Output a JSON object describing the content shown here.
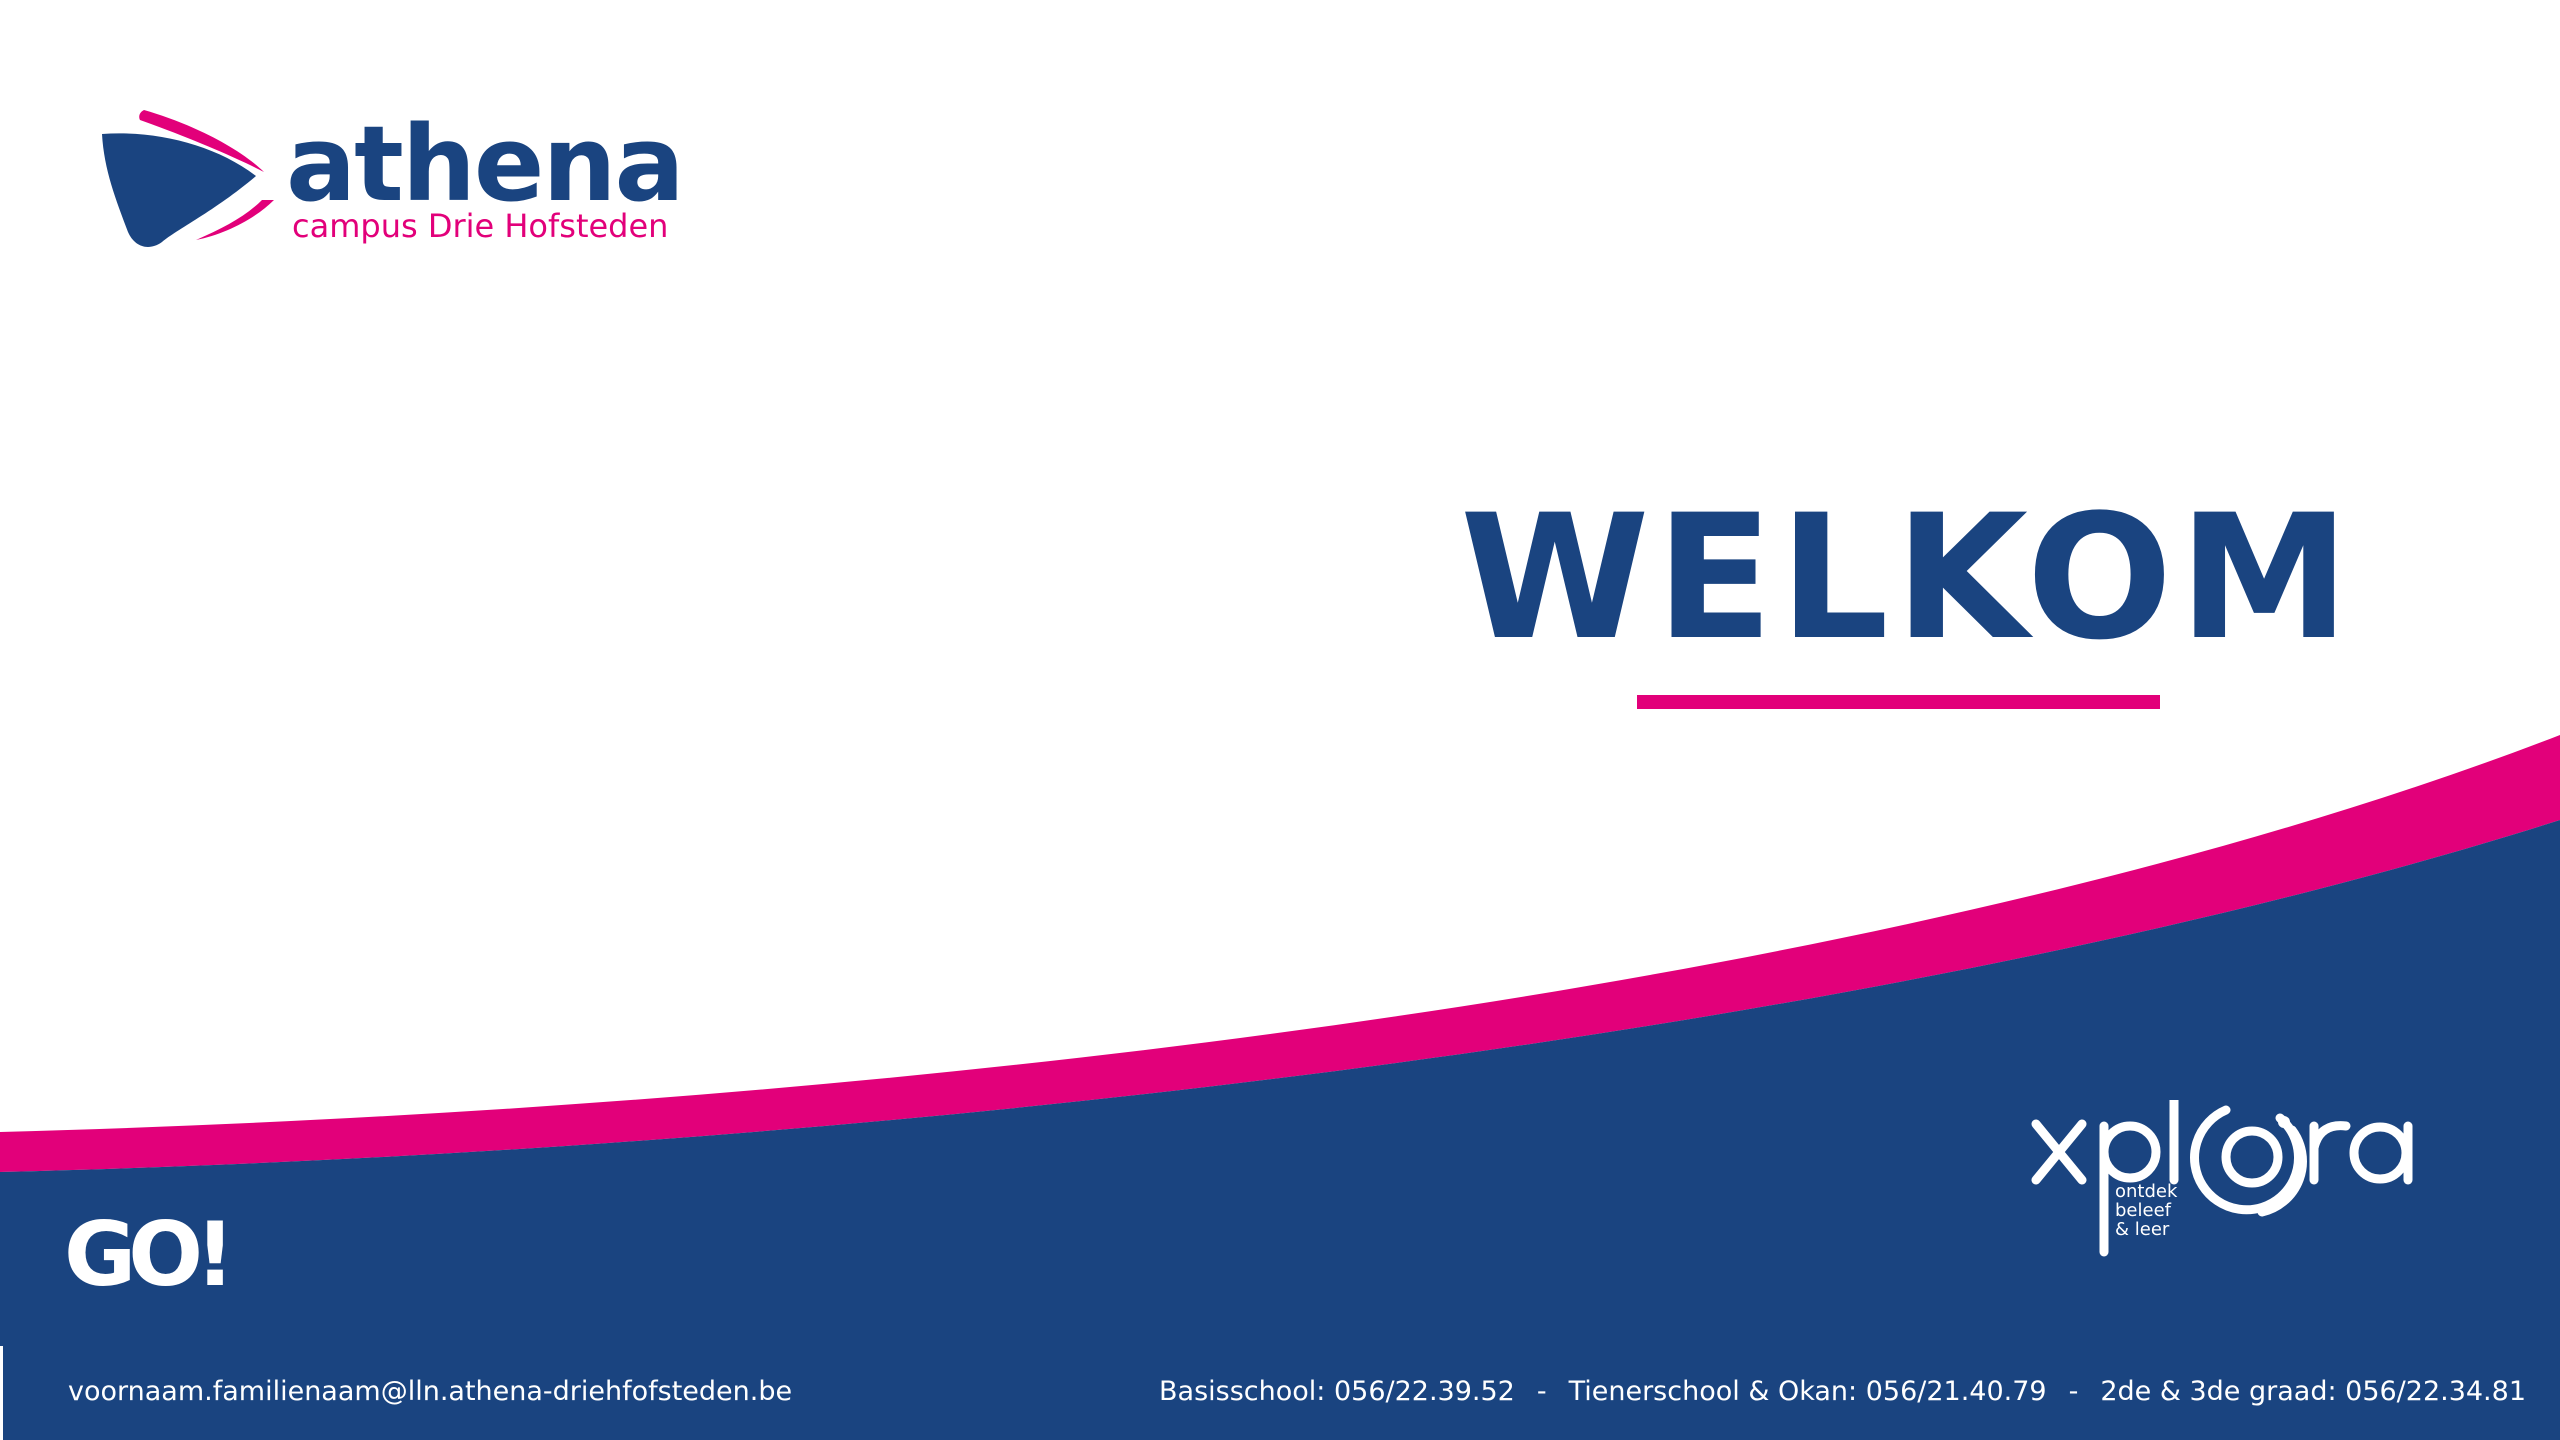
{
  "colors": {
    "brand_blue": "#1a4480",
    "brand_pink": "#e2007a",
    "background": "#ffffff",
    "footer_text": "#ffffff"
  },
  "header": {
    "logo_word": "athena",
    "logo_subtitle": "campus Drie Hofsteden"
  },
  "main": {
    "heading": "WELKOM"
  },
  "bottom": {
    "go_logo_text": "GO!",
    "xplora": {
      "word": "xplora",
      "tagline": [
        "ontdek",
        "beleef",
        "& leer"
      ]
    }
  },
  "footer": {
    "email": "voornaam.familienaam@lln.athena-driehfofsteden.be",
    "phones": [
      "Basisschool: 056/22.39.52",
      "Tienerschool & Okan: 056/21.40.79",
      "2de & 3de graad: 056/22.34.81"
    ],
    "separator": "-"
  },
  "icons": [
    "athena-logo-mark-icon",
    "go-logo-icon",
    "xplora-logo-icon"
  ]
}
